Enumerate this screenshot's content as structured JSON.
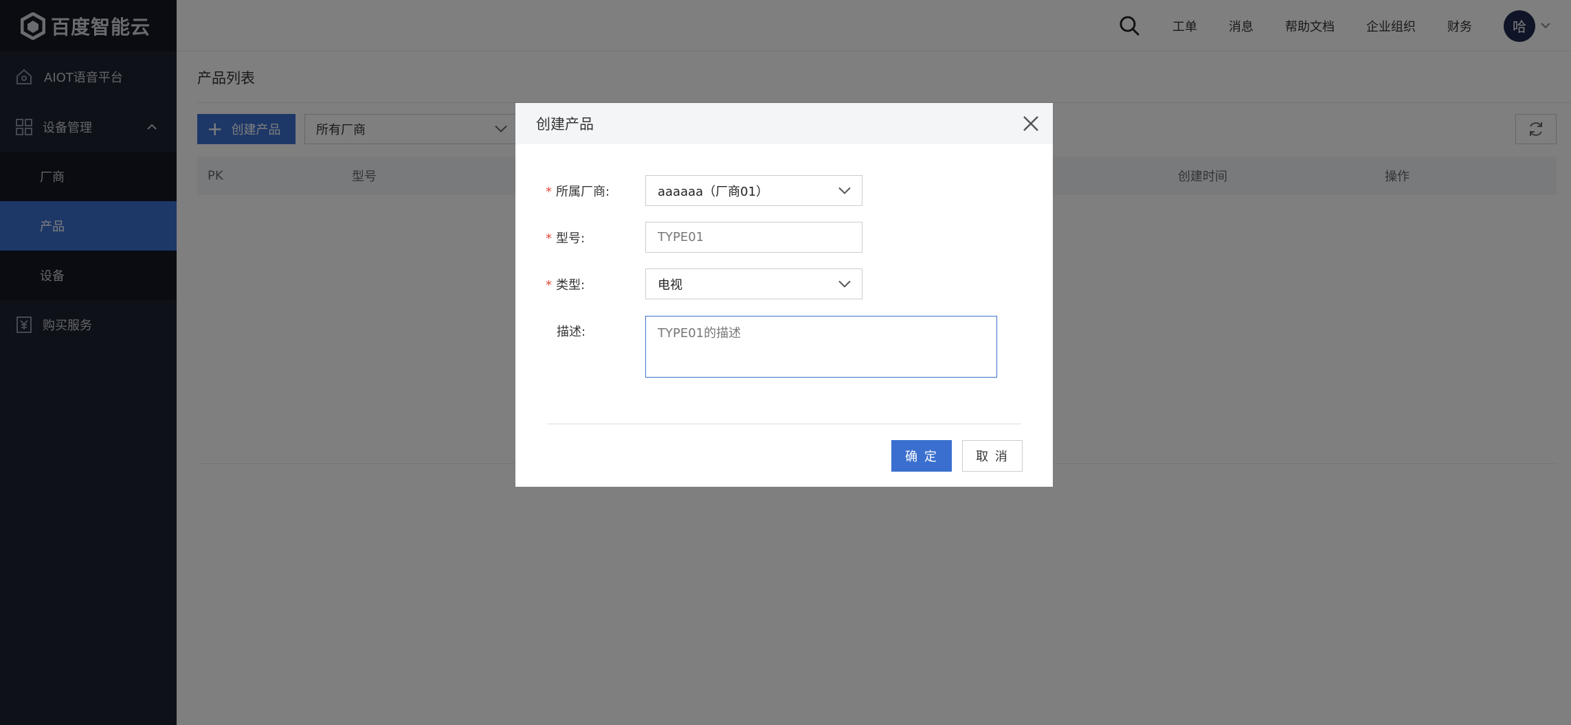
{
  "brand": {
    "name": "百度智能云"
  },
  "sidebar": {
    "items": [
      {
        "label": "AIOT语音平台",
        "icon": "home-icon"
      },
      {
        "label": "设备管理",
        "icon": "grid-icon"
      },
      {
        "label": "厂商"
      },
      {
        "label": "产品"
      },
      {
        "label": "设备"
      },
      {
        "label": "购买服务",
        "icon": "purchase-icon"
      }
    ],
    "active": "产品"
  },
  "header": {
    "links": [
      "工单",
      "消息",
      "帮助文档",
      "企业组织",
      "财务"
    ],
    "avatar": "哈"
  },
  "main": {
    "title": "产品列表",
    "create_button": "创建产品",
    "vendor_filter": "所有厂商",
    "columns": [
      "PK",
      "型号",
      "创建时间",
      "操作"
    ]
  },
  "modal": {
    "title": "创建产品",
    "fields": {
      "vendor_label": "所属厂商:",
      "vendor_value": "aaaaaa（厂商01）",
      "model_label": "型号:",
      "model_value": "TYPE01",
      "type_label": "类型:",
      "type_value": "电视",
      "desc_label": "描述:",
      "desc_value": "TYPE01的描述"
    },
    "ok_label": "确 定",
    "cancel_label": "取 消"
  },
  "colors": {
    "accent": "#3a6fcf",
    "sidebar": "#1d2230",
    "required": "#e24a3c"
  }
}
